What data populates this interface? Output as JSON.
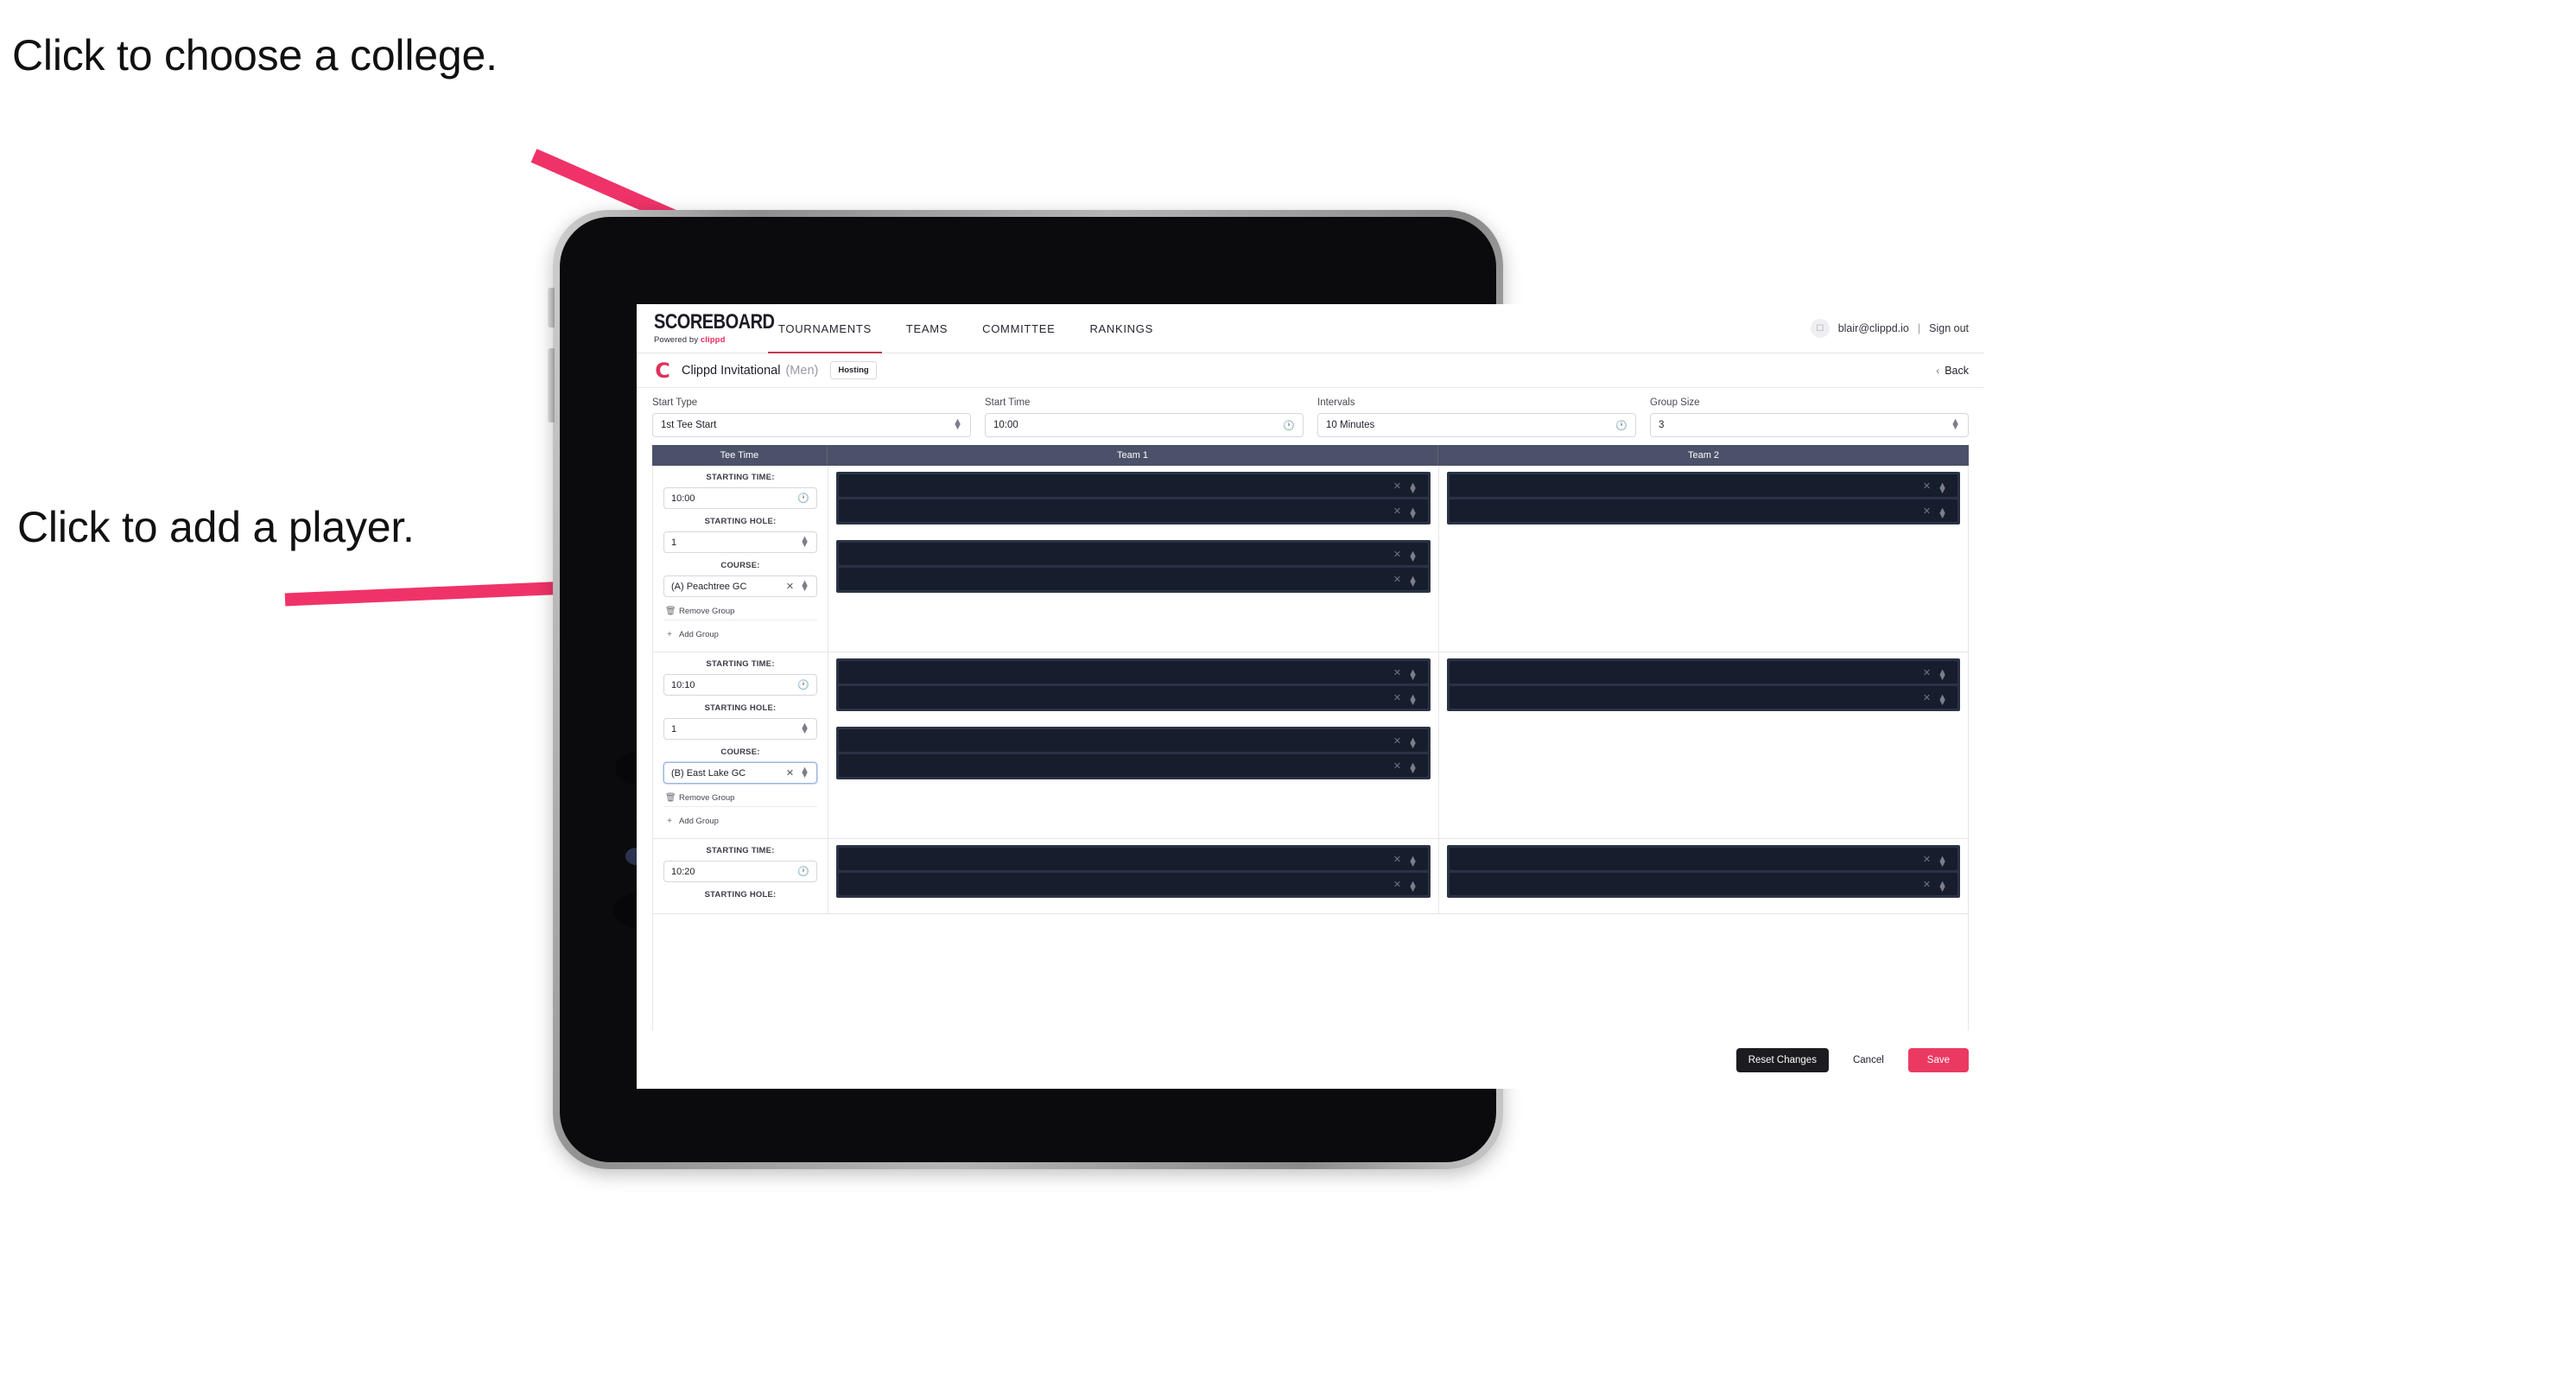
{
  "annotations": [
    {
      "id": "college",
      "text": "Click to choose a college."
    },
    {
      "id": "player",
      "text": "Click to add a player."
    }
  ],
  "colors": {
    "accent_pink": "#ea3a62",
    "brand_pink": "#e0315c",
    "table_header": "#4b5168",
    "slot_dark": "#161d2c",
    "slot_frame": "#2b3245",
    "tab_underline": "#c13a52"
  },
  "navbar": {
    "brand_word": "SCOREBOARD",
    "brand_sub_prefix": "Powered by",
    "brand_sub_name": "clippd",
    "tabs": [
      {
        "label": "TOURNAMENTS",
        "active": true
      },
      {
        "label": "TEAMS",
        "active": false
      },
      {
        "label": "COMMITTEE",
        "active": false
      },
      {
        "label": "RANKINGS",
        "active": false
      }
    ],
    "avatar_icon": "user-avatar-icon",
    "user_email": "blair@clippd.io",
    "separator": "|",
    "sign_out": "Sign out"
  },
  "tournament_bar": {
    "logo_glyph": "C",
    "name": "Clippd Invitational",
    "gender": "(Men)",
    "status_badge": "Hosting",
    "back_chevron": "‹",
    "back_label": "Back"
  },
  "filters": [
    {
      "label": "Start Type",
      "value": "1st Tee Start",
      "icon": "stepper-icon"
    },
    {
      "label": "Start Time",
      "value": "10:00",
      "icon": "clock-icon"
    },
    {
      "label": "Intervals",
      "value": "10 Minutes",
      "icon": "clock-icon"
    },
    {
      "label": "Group Size",
      "value": "3",
      "icon": "stepper-icon"
    }
  ],
  "table": {
    "headers": [
      "Tee Time",
      "Team 1",
      "Team 2"
    ],
    "labels": {
      "starting_time": "STARTING TIME:",
      "starting_hole": "STARTING HOLE:",
      "course": "COURSE:",
      "remove_group": "Remove Group",
      "add_group": "Add Group",
      "remove_icon": "trash-icon",
      "add_icon": "plus-icon"
    },
    "groups": [
      {
        "starting_time": "10:00",
        "starting_hole": "1",
        "course": "(A) Peachtree GC",
        "course_focused": false,
        "team1_slot_rows": [
          2,
          2
        ],
        "team2_slot_rows": [
          2
        ]
      },
      {
        "starting_time": "10:10",
        "starting_hole": "1",
        "course": "(B) East Lake GC",
        "course_focused": true,
        "team1_slot_rows": [
          2,
          2
        ],
        "team2_slot_rows": [
          2
        ]
      },
      {
        "starting_time": "10:20",
        "starting_hole": "",
        "course": "",
        "course_focused": false,
        "team1_slot_rows": [
          2
        ],
        "team2_slot_rows": [
          2
        ]
      }
    ]
  },
  "footer": {
    "reset": "Reset Changes",
    "cancel": "Cancel",
    "save": "Save"
  }
}
